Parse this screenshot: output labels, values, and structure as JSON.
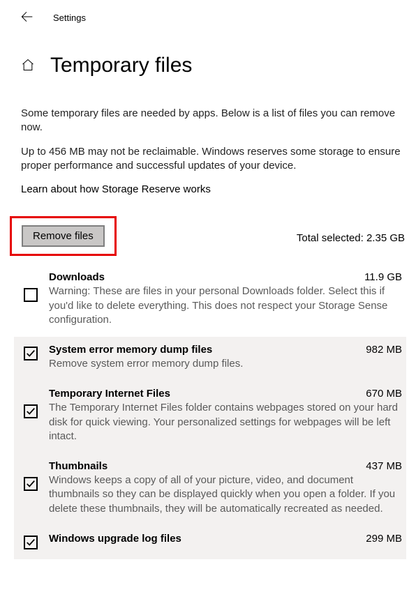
{
  "topbar": {
    "settings_label": "Settings"
  },
  "page": {
    "title": "Temporary files",
    "paragraph1": "Some temporary files are needed by apps. Below is a list of files you can remove now.",
    "paragraph2": "Up to 456 MB may not be reclaimable. Windows reserves some storage to ensure proper performance and successful updates of your device.",
    "storage_link": "Learn about how Storage Reserve works"
  },
  "action": {
    "remove_label": "Remove files",
    "total_label": "Total selected: 2.35 GB"
  },
  "items": [
    {
      "name": "Downloads",
      "size": "11.9 GB",
      "desc": "Warning: These are files in your personal Downloads folder. Select this if you'd like to delete everything. This does not respect your Storage Sense configuration.",
      "checked": false
    },
    {
      "name": "System error memory dump files",
      "size": "982 MB",
      "desc": "Remove system error memory dump files.",
      "checked": true
    },
    {
      "name": "Temporary Internet Files",
      "size": "670 MB",
      "desc": "The Temporary Internet Files folder contains webpages stored on your hard disk for quick viewing. Your personalized settings for webpages will be left intact.",
      "checked": true
    },
    {
      "name": "Thumbnails",
      "size": "437 MB",
      "desc": "Windows keeps a copy of all of your picture, video, and document thumbnails so they can be displayed quickly when you open a folder. If you delete these thumbnails, they will be automatically recreated as needed.",
      "checked": true
    },
    {
      "name": "Windows upgrade log files",
      "size": "299 MB",
      "desc": "",
      "checked": true
    }
  ]
}
